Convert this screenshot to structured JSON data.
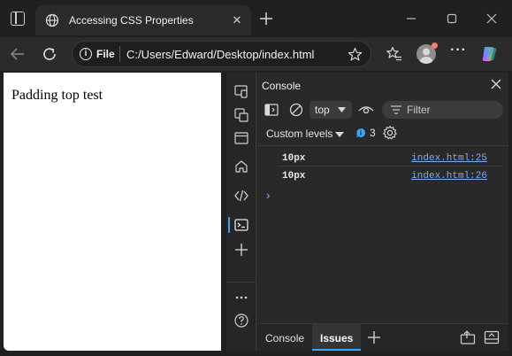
{
  "tab": {
    "title": "Accessing CSS Properties",
    "close_glyph": "✕"
  },
  "address_bar": {
    "scheme": "File",
    "url": "C:/Users/Edward/Desktop/index.html"
  },
  "page": {
    "text": "Padding top test"
  },
  "devtools": {
    "panel_title": "Console",
    "context": "top",
    "filter_placeholder": "Filter",
    "levels_label": "Custom levels",
    "issues_count": "3",
    "messages": [
      {
        "text": "10px",
        "source": "index.html:25"
      },
      {
        "text": "10px",
        "source": "index.html:26"
      }
    ],
    "prompt": "›",
    "drawer_tabs": [
      "Console",
      "Issues"
    ],
    "active_drawer_tab": "Issues"
  },
  "colors": {
    "accent": "#3ea6ff",
    "link": "#7cacf8",
    "profile_dot": "#f08070"
  }
}
